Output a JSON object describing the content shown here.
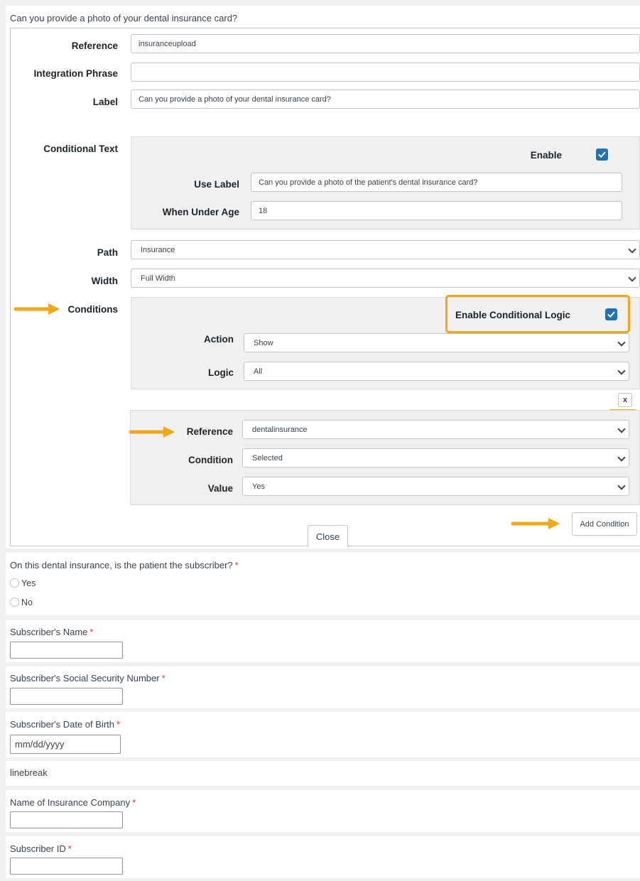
{
  "question": {
    "title": "Can you provide a photo of your dental insurance card?"
  },
  "editor": {
    "reference_label": "Reference",
    "reference_value": "insuranceupload",
    "integration_label": "Integration Phrase",
    "integration_value": "",
    "label_label": "Label",
    "label_value": "Can you provide a photo of your dental insurance card?",
    "conditional_text_label": "Conditional Text",
    "conditional_text": {
      "enable_label": "Enable",
      "enabled": true,
      "use_label_label": "Use Label",
      "use_label_value": "Can you provide a photo of the patient's dental insurance card?",
      "under_age_label": "When Under Age",
      "under_age_value": "18"
    },
    "path_label": "Path",
    "path_value": "Insurance",
    "width_label": "Width",
    "width_value": "Full Width",
    "conditions_label": "Conditions",
    "conditions": {
      "enable_logic_label": "Enable Conditional Logic",
      "enable_logic": true,
      "action_label": "Action",
      "action_value": "Show",
      "logic_label": "Logic",
      "logic_value": "All",
      "remove_label": "x",
      "rule": {
        "reference_label": "Reference",
        "reference_value": "dentalinsurance",
        "condition_label": "Condition",
        "condition_value": "Selected",
        "value_label": "Value",
        "value_value": "Yes"
      },
      "add_condition_label": "Add Condition"
    },
    "close_label": "Close"
  },
  "form": {
    "subscriber_question": "On this dental insurance, is the patient the subscriber?",
    "options": [
      "Yes",
      "No"
    ],
    "subscriber_name": "Subscriber's Name",
    "ssn": "Subscriber's Social Security Number",
    "dob": "Subscriber's Date of Birth",
    "dob_placeholder": "mm/dd/yyyy",
    "linebreak": "linebreak",
    "insurance_company": "Name of Insurance Company",
    "subscriber_id": "Subscriber ID",
    "required_mark": "*"
  },
  "colors": {
    "accent": "#2271b1",
    "highlight": "#f0a71a",
    "required": "#d63638"
  }
}
